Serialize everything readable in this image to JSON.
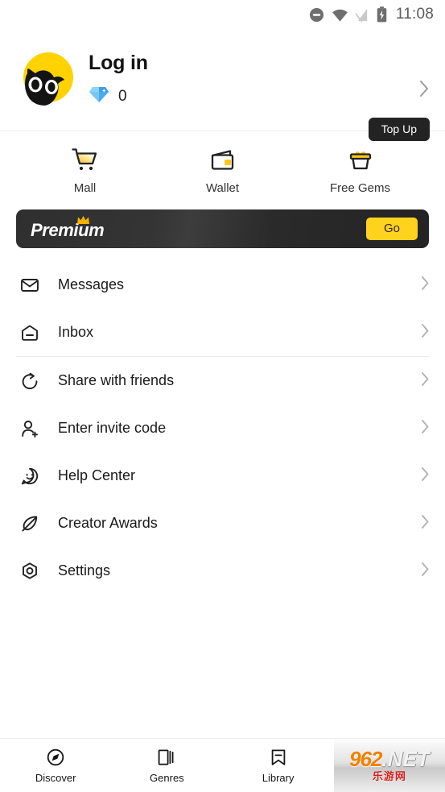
{
  "status_bar": {
    "time": "11:08",
    "icons": [
      "do-not-disturb-icon",
      "wifi-icon",
      "signal-off-icon",
      "battery-charging-icon"
    ]
  },
  "profile": {
    "avatar_icon": "cat-avatar",
    "login_label": "Log in",
    "gem_icon": "gem-icon",
    "gem_count": "0",
    "topup_label": "Top Up",
    "chevron_icon": "chevron-right-icon"
  },
  "quick_actions": [
    {
      "label": "Mall",
      "icon": "shopping-cart-icon"
    },
    {
      "label": "Wallet",
      "icon": "wallet-icon"
    },
    {
      "label": "Free Gems",
      "icon": "gift-basket-icon"
    }
  ],
  "premium": {
    "title": "Premium",
    "crown_icon": "crown-icon",
    "cta_label": "Go"
  },
  "menu": [
    {
      "label": "Messages",
      "icon": "envelope-icon"
    },
    {
      "label": "Inbox",
      "icon": "inbox-icon"
    },
    {
      "label": "Share with friends",
      "icon": "share-circle-icon"
    },
    {
      "label": "Enter invite code",
      "icon": "person-add-icon"
    },
    {
      "label": "Help Center",
      "icon": "smiley-chat-icon"
    },
    {
      "label": "Creator Awards",
      "icon": "feather-pen-icon"
    },
    {
      "label": "Settings",
      "icon": "settings-gear-icon"
    }
  ],
  "bottom_nav": [
    {
      "label": "Discover",
      "icon": "compass-icon"
    },
    {
      "label": "Genres",
      "icon": "books-icon"
    },
    {
      "label": "Library",
      "icon": "bookmark-icon"
    }
  ],
  "watermark": {
    "brand": "962",
    "tld": ".NET",
    "subtitle": "乐游网"
  },
  "colors": {
    "accent_yellow": "#ffd21e",
    "avatar_yellow": "#ffd200",
    "dark": "#232323",
    "gem_blue": "#49aaf5",
    "watermark_orange": "#f08100",
    "watermark_red": "#d81f1f"
  }
}
